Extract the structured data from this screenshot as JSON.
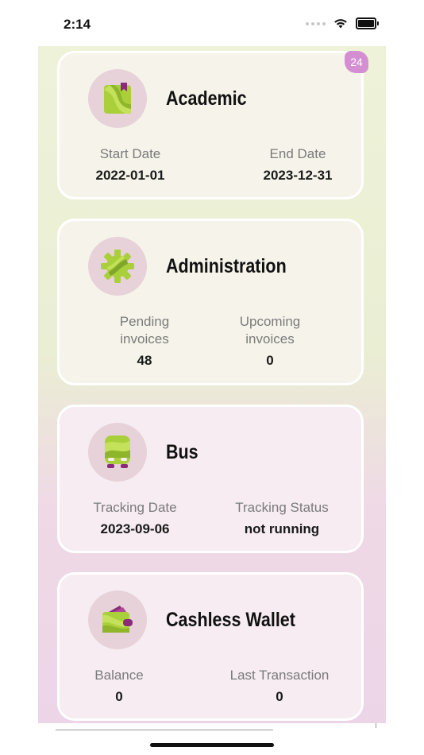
{
  "status_bar": {
    "time": "2:14"
  },
  "badge_count": "24",
  "cards": [
    {
      "title": "Academic",
      "icon": "book-icon",
      "stats": [
        {
          "label": "Start Date",
          "value": "2022-01-01"
        },
        {
          "label": "End Date",
          "value": "2023-12-31"
        }
      ]
    },
    {
      "title": "Administration",
      "icon": "gear-icon",
      "stats": [
        {
          "label": "Pending invoices",
          "value": "48"
        },
        {
          "label": "Upcoming invoices",
          "value": "0"
        }
      ]
    },
    {
      "title": "Bus",
      "icon": "bus-icon",
      "stats": [
        {
          "label": "Tracking Date",
          "value": "2023-09-06"
        },
        {
          "label": "Tracking Status",
          "value": "not running"
        }
      ]
    },
    {
      "title": "Cashless Wallet",
      "icon": "wallet-icon",
      "stats": [
        {
          "label": "Balance",
          "value": "0"
        },
        {
          "label": "Last Transaction",
          "value": "0"
        }
      ]
    }
  ],
  "colors": {
    "accent_green": "#a9cf3a",
    "accent_purple": "#8a2a7a",
    "badge": "#d38fd2"
  }
}
